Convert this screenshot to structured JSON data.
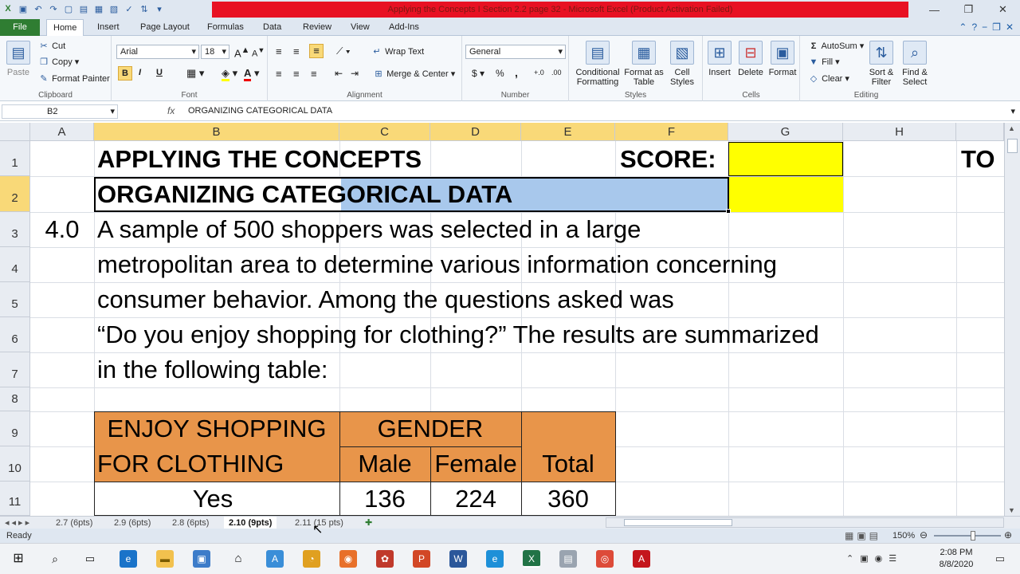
{
  "window": {
    "title": "Applying the Concepts I Section 2.2 page 32 - Microsoft Excel (Product Activation Failed)"
  },
  "tabs": [
    {
      "label": "File"
    },
    {
      "label": "Home"
    },
    {
      "label": "Insert"
    },
    {
      "label": "Page Layout"
    },
    {
      "label": "Formulas"
    },
    {
      "label": "Data"
    },
    {
      "label": "Review"
    },
    {
      "label": "View"
    },
    {
      "label": "Add-Ins"
    }
  ],
  "ribbon": {
    "clipboard": {
      "label": "Clipboard",
      "paste": "Paste",
      "cut": "Cut",
      "copy": "Copy",
      "format_painter": "Format Painter"
    },
    "font": {
      "label": "Font",
      "name": "Arial",
      "size": "18",
      "bold": "B",
      "italic": "I",
      "underline": "U"
    },
    "alignment": {
      "label": "Alignment",
      "wrap_text": "Wrap Text",
      "merge_center": "Merge & Center"
    },
    "number": {
      "label": "Number",
      "format": "General",
      "currency": "$",
      "percent": "%",
      "comma": ","
    },
    "styles": {
      "label": "Styles",
      "conditional": "Conditional Formatting",
      "format_table": "Format as Table",
      "cell_styles": "Cell Styles"
    },
    "cells": {
      "label": "Cells",
      "insert": "Insert",
      "delete": "Delete",
      "format": "Format"
    },
    "editing": {
      "label": "Editing",
      "autosum": "AutoSum",
      "fill": "Fill",
      "clear": "Clear",
      "sort": "Sort & Filter",
      "find": "Find & Select"
    }
  },
  "formula_bar": {
    "name_box": "B2",
    "fx": "fx",
    "content": "ORGANIZING CATEGORICAL DATA"
  },
  "columns": [
    "A",
    "B",
    "C",
    "D",
    "E",
    "F",
    "G",
    "H"
  ],
  "rows": [
    "1",
    "2",
    "3",
    "4",
    "5",
    "6",
    "7",
    "8",
    "9",
    "10",
    "11"
  ],
  "cells": {
    "b1": "APPLYING THE CONCEPTS",
    "f1": "SCORE:",
    "i1": "TO",
    "b2": "ORGANIZING CATEGORICAL DATA",
    "a3": "4.0",
    "b3": "A sample of 500 shoppers was selected in a large",
    "b4": "metropolitan area to determine various information concerning",
    "b5": "consumer behavior. Among the questions asked was",
    "b6": "“Do you enjoy shopping for clothing?” The results are summarized",
    "b7": "in the following table:",
    "b9": "ENJOY SHOPPING",
    "b10": "FOR CLOTHING",
    "c9": "GENDER",
    "c10": "Male",
    "d10": "Female",
    "e10": "Total",
    "b11": "Yes",
    "c11": "136",
    "d11": "224",
    "e11": "360"
  },
  "sheets": [
    {
      "label": "2.7 (6pts)"
    },
    {
      "label": "2.9 (6pts)"
    },
    {
      "label": "2.8 (6pts)"
    },
    {
      "label": "2.10 (9pts)"
    },
    {
      "label": "2.11 (15 pts)"
    }
  ],
  "status": {
    "ready": "Ready",
    "zoom": "150%"
  },
  "clock": {
    "time": "2:08 PM",
    "date": "8/8/2020"
  },
  "colors": {
    "accent": "#2f7d32",
    "title_bar": "#e81123",
    "highlight": "#ffff00",
    "table_header": "#e8954a",
    "selection": "#a8c8ec"
  }
}
